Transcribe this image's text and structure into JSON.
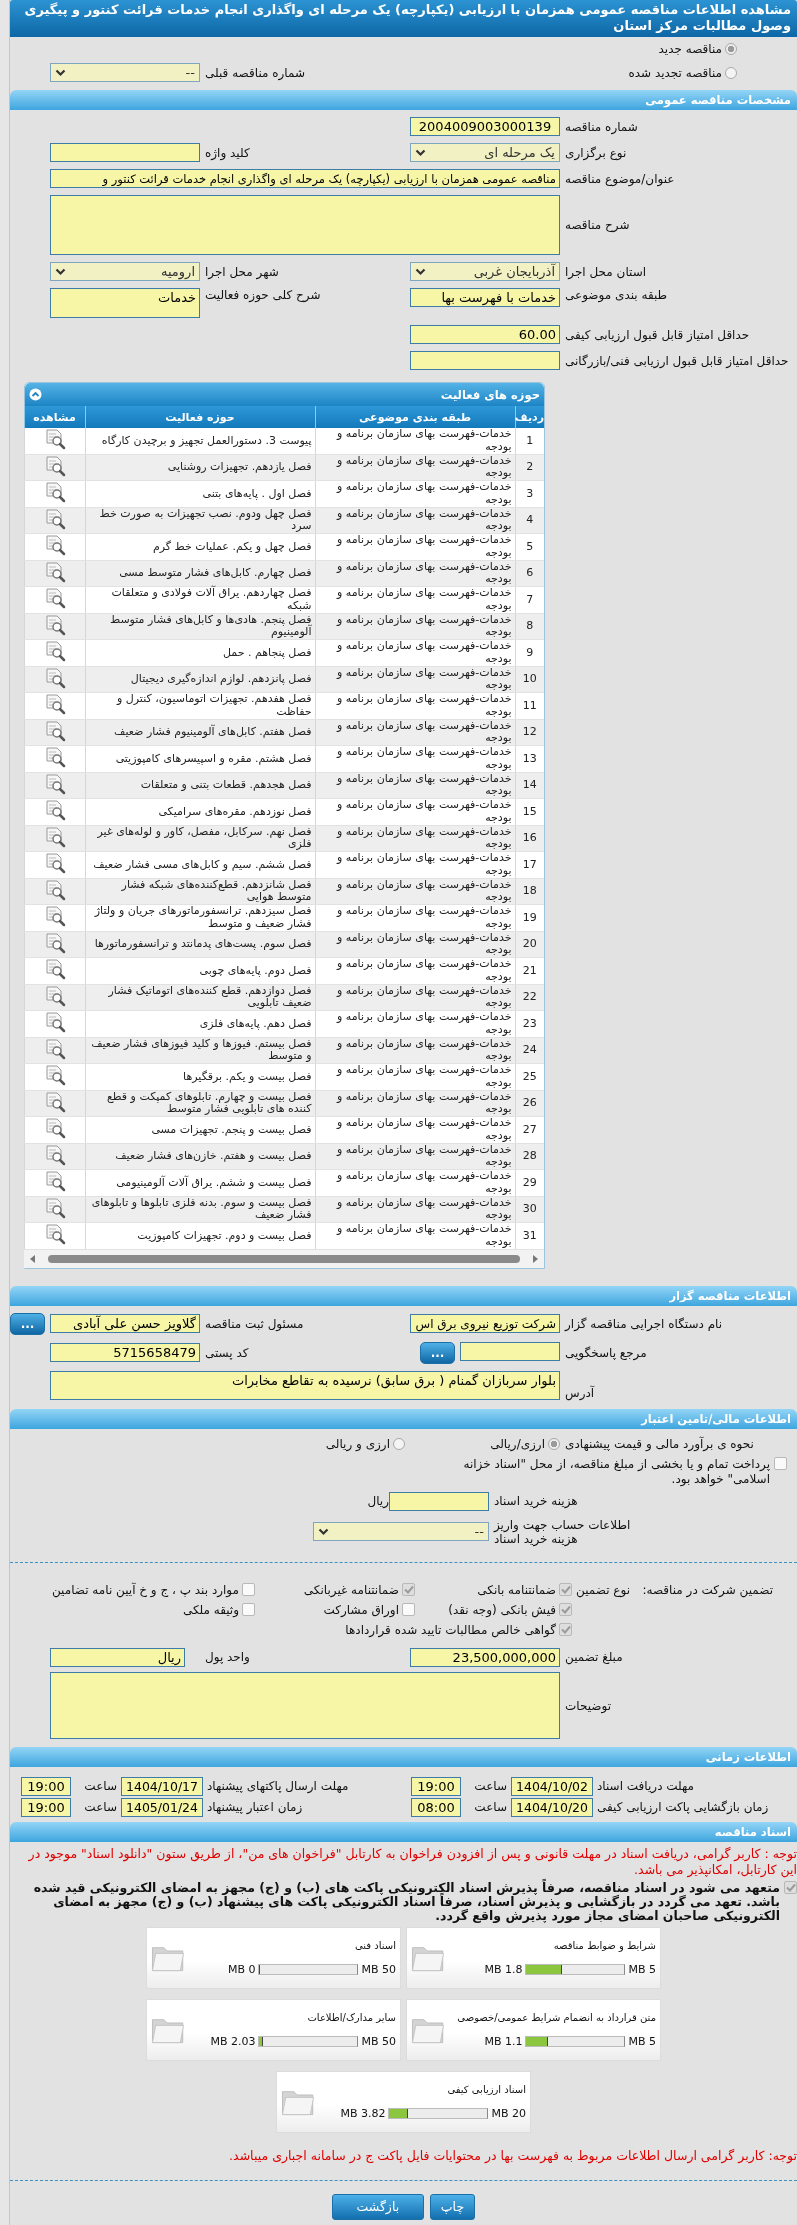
{
  "title": "مشاهده اطلاعات مناقصه عمومی همزمان با ارزیابی (یکپارچه) یک مرحله ای واگذاری انجام خدمات قرائت کنتور و پیگیری وصول مطالبات مرکز استان",
  "tender_status": [
    {
      "label": "مناقصه جدید",
      "selected": true
    },
    {
      "label": "مناقصه تجدید شده",
      "selected": false
    }
  ],
  "previous_tender": {
    "label": "شماره مناقصه قبلی",
    "value": "--"
  },
  "general": {
    "header": "مشخصات مناقصه عمومی",
    "tender_number": {
      "label": "شماره مناقصه",
      "value": "2004009003000139"
    },
    "holding_type": {
      "label": "نوع برگزاری",
      "value": "یک مرحله ای"
    },
    "keyword": {
      "label": "کلید واژه"
    },
    "subject": {
      "label": "عنوان/موضوع مناقصه",
      "value": "مناقصه عمومی همزمان با ارزیابی (یکپارچه) یک مرحله ای واگذاری انجام خدمات قرائت کنتور و"
    },
    "description": {
      "label": "شرح مناقصه"
    },
    "province": {
      "label": "استان محل اجرا",
      "value": "آذربایجان غربی"
    },
    "city": {
      "label": "شهر محل اجرا",
      "value": "ارومیه"
    },
    "category": {
      "label": "طبقه بندی موضوعی",
      "value": "خدمات با فهرست بها"
    },
    "activity_summary": {
      "label": "شرح کلی حوزه فعالیت",
      "value": "خدمات"
    },
    "min_quality_score": {
      "label": "حداقل امتیاز قابل قبول ارزیابی کیفی",
      "value": "60.00"
    },
    "min_technical_score": {
      "label": "حداقل امتیاز قابل قبول ارزیابی فنی/بازرگانی"
    }
  },
  "activities": {
    "header": "حوزه های فعالیت",
    "columns": [
      "ردیف",
      "طبقه بندی موضوعی",
      "حوزه فعالیت",
      "مشاهده"
    ],
    "rows": [
      {
        "index": "1",
        "category": "خدمات-فهرست بهای سازمان برنامه و بودجه",
        "activity": "پیوست 3. دستورالعمل تجهیز و برچیدن کارگاه"
      },
      {
        "index": "2",
        "category": "خدمات-فهرست بهای سازمان برنامه و بودجه",
        "activity": "فصل یازدهم. تجهیزات روشنایی"
      },
      {
        "index": "3",
        "category": "خدمات-فهرست بهای سازمان برنامه و بودجه",
        "activity": "فصل اول . پایه‌های بتنی"
      },
      {
        "index": "4",
        "category": "خدمات-فهرست بهای سازمان برنامه و بودجه",
        "activity": "فصل چهل ودوم. نصب تجهیزات به صورت خط سرد"
      },
      {
        "index": "5",
        "category": "خدمات-فهرست بهای سازمان برنامه و بودجه",
        "activity": "فصل چهل و یکم. عملیات خط گرم"
      },
      {
        "index": "6",
        "category": "خدمات-فهرست بهای سازمان برنامه و بودجه",
        "activity": "فصل چهارم. کابل‌های فشار متوسط مسی"
      },
      {
        "index": "7",
        "category": "خدمات-فهرست بهای سازمان برنامه و بودجه",
        "activity": "فصل چهاردهم. یراق آلات فولادی و متعلقات شبکه"
      },
      {
        "index": "8",
        "category": "خدمات-فهرست بهای سازمان برنامه و بودجه",
        "activity": "فصل پنجم. هادی‌ها و کابل‌های فشار متوسط آلومینیوم"
      },
      {
        "index": "9",
        "category": "خدمات-فهرست بهای سازمان برنامه و بودجه",
        "activity": "فصل پنجاهم . حمل"
      },
      {
        "index": "10",
        "category": "خدمات-فهرست بهای سازمان برنامه و بودجه",
        "activity": "فصل پانزدهم. لوازم اندازه‌گیری دیجیتال"
      },
      {
        "index": "11",
        "category": "خدمات-فهرست بهای سازمان برنامه و بودجه",
        "activity": "فصل هفدهم. تجهیزات اتوماسیون، کنترل و حفاظت"
      },
      {
        "index": "12",
        "category": "خدمات-فهرست بهای سازمان برنامه و بودجه",
        "activity": "فصل هفتم. کابل‌های آلومینیوم فشار ضعیف"
      },
      {
        "index": "13",
        "category": "خدمات-فهرست بهای سازمان برنامه و بودجه",
        "activity": "فصل هشتم. مقره و اسپیسرهای کامپوزیتی"
      },
      {
        "index": "14",
        "category": "خدمات-فهرست بهای سازمان برنامه و بودجه",
        "activity": "فصل هجدهم. قطعات بتنی و متعلقات"
      },
      {
        "index": "15",
        "category": "خدمات-فهرست بهای سازمان برنامه و بودجه",
        "activity": "فصل نوزدهم. مقره‌های سرامیکی"
      },
      {
        "index": "16",
        "category": "خدمات-فهرست بهای سازمان برنامه و بودجه",
        "activity": "فصل نهم. سرکابل، مفصل، کاور و لوله‌های غیر فلزی"
      },
      {
        "index": "17",
        "category": "خدمات-فهرست بهای سازمان برنامه و بودجه",
        "activity": "فصل ششم. سیم و کابل‌های مسی فشار ضعیف"
      },
      {
        "index": "18",
        "category": "خدمات-فهرست بهای سازمان برنامه و بودجه",
        "activity": "فصل شانزدهم. قطع‌کننده‌های شبکه فشار متوسط هوایی"
      },
      {
        "index": "19",
        "category": "خدمات-فهرست بهای سازمان برنامه و بودجه",
        "activity": "فصل سیزدهم. ترانسفورماتورهای جریان و ولتاژ فشار ضعیف و متوسط"
      },
      {
        "index": "20",
        "category": "خدمات-فهرست بهای سازمان برنامه و بودجه",
        "activity": "فصل سوم. پست‌های پدمانتد و ترانسفورماتورها"
      },
      {
        "index": "21",
        "category": "خدمات-فهرست بهای سازمان برنامه و بودجه",
        "activity": "فصل دوم. پایه‌های چوبی"
      },
      {
        "index": "22",
        "category": "خدمات-فهرست بهای سازمان برنامه و بودجه",
        "activity": "فصل دوازدهم. قطع کننده‌های اتوماتیک فشار ضعیف تابلویی"
      },
      {
        "index": "23",
        "category": "خدمات-فهرست بهای سازمان برنامه و بودجه",
        "activity": "فصل دهم. پایه‌های فلزی"
      },
      {
        "index": "24",
        "category": "خدمات-فهرست بهای سازمان برنامه و بودجه",
        "activity": "فصل بیستم. فیوزها و کلید فیوزهای فشار ضعیف و متوسط"
      },
      {
        "index": "25",
        "category": "خدمات-فهرست بهای سازمان برنامه و بودجه",
        "activity": "فصل بیست و یکم. برقگیرها"
      },
      {
        "index": "26",
        "category": "خدمات-فهرست بهای سازمان برنامه و بودجه",
        "activity": "فصل بیست و چهارم. تابلوهای کمپکت و قطع کننده های تابلویی فشار متوسط"
      },
      {
        "index": "27",
        "category": "خدمات-فهرست بهای سازمان برنامه و بودجه",
        "activity": "فصل بیست و پنجم. تجهیزات مسی"
      },
      {
        "index": "28",
        "category": "خدمات-فهرست بهای سازمان برنامه و بودجه",
        "activity": "فصل بیست و هفتم. خازن‌های فشار ضعیف"
      },
      {
        "index": "29",
        "category": "خدمات-فهرست بهای سازمان برنامه و بودجه",
        "activity": "فصل بیست و ششم. یراق آلات آلومینیومی"
      },
      {
        "index": "30",
        "category": "خدمات-فهرست بهای سازمان برنامه و بودجه",
        "activity": "فصل بیست و سوم. بدنه فلزی تابلوها و تابلوهای فشار ضعیف"
      },
      {
        "index": "31",
        "category": "خدمات-فهرست بهای سازمان برنامه و بودجه",
        "activity": "فصل بیست و دوم. تجهیزات کامپوزیت"
      }
    ]
  },
  "tenderer": {
    "header": "اطلاعات مناقصه گزار",
    "organization": {
      "label": "نام دستگاه اجرایی مناقصه گزار",
      "value": "شرکت توزیع نیروی برق اس"
    },
    "registrar": {
      "label": "مسئول ثبت مناقصه",
      "value": "گلاویز حسن علی آبادی"
    },
    "registrar_button": "...",
    "response_ref": {
      "label": "مرجع پاسخگویی"
    },
    "response_button": "...",
    "postal_code": {
      "label": "کد پستی",
      "value": "5715658479"
    },
    "address": {
      "label": "آدرس",
      "value": "بلوار سربازان گمنام ( برق سابق) نرسیده به تقاطع مخابرات"
    }
  },
  "financial": {
    "header": "اطلاعات مالی/تامین اعتبار",
    "estimate_label": "نحوه ی برآورد مالی و قیمت پیشنهادی",
    "estimate_options": [
      {
        "label": "ارزی/ریالی",
        "selected": true
      },
      {
        "label": "ارزی و ریالی",
        "selected": false
      }
    ],
    "treasury": {
      "label": "پرداخت تمام و یا بخشی از مبلغ مناقصه، از محل \"اسناد خزانه اسلامی\" خواهد بود.",
      "checked": false
    },
    "document_fee": {
      "label": "هزینه خرید اسناد",
      "unit": "ریال"
    },
    "account": {
      "label": "اطلاعات حساب جهت واریز هزینه خرید اسناد",
      "value": "--"
    },
    "guarantee_title": "تضمین شرکت در مناقصه:",
    "guarantee_type_label": "نوع تضمین",
    "guarantee_types": [
      {
        "label": "ضمانتنامه بانکی",
        "checked": true
      },
      {
        "label": "ضمانتنامه غیربانکی",
        "checked": true
      },
      {
        "label": "موارد بند پ ، ج و خ آیین نامه تضامین",
        "checked": false
      },
      {
        "label": "فیش بانکی (وجه نقد)",
        "checked": true
      },
      {
        "label": "اوراق مشارکت",
        "checked": false
      },
      {
        "label": "وثیقه ملکی",
        "checked": false
      },
      {
        "label": "گواهی خالص مطالبات تایید شده قراردادها",
        "checked": true
      }
    ],
    "guarantee_amount": {
      "label": "مبلغ تضمین",
      "value": "23,500,000,000"
    },
    "currency": {
      "label": "واحد پول",
      "value": "ریال"
    },
    "notes": {
      "label": "توضیحات"
    }
  },
  "schedule": {
    "header": "اطلاعات زمانی",
    "items": [
      {
        "label": "مهلت دریافت اسناد",
        "date": "1404/10/02",
        "time_label": "ساعت",
        "time": "19:00"
      },
      {
        "label": "مهلت ارسال پاکتهای پیشنهاد",
        "date": "1404/10/17",
        "time_label": "ساعت",
        "time": "19:00"
      },
      {
        "label": "زمان بازگشایی پاکت ارزیابی کیفی",
        "date": "1404/10/20",
        "time_label": "ساعت",
        "time": "08:00"
      },
      {
        "label": "زمان اعتبار پیشنهاد",
        "date": "1405/01/24",
        "time_label": "ساعت",
        "time": "19:00"
      }
    ]
  },
  "documents": {
    "header": "اسناد مناقصه",
    "notice": "توجه : کاربر گرامی، دریافت اسناد در مهلت قانونی و پس از افزودن فراخوان به کارتابل \"فراخوان های من\"، از طریق ستون \"دانلود اسناد\" موجود در این کارتابل، امکانپذیر می باشد.",
    "commitment": {
      "text": "متعهد می شود در اسناد مناقصه، صرفاً پذیرش اسناد الکترونیکی پاکت های (ب) و (ج) مجهز به امضای الکترونیکی قید شده باشد. تعهد می گردد در بازگشایی و پذیرش اسناد، صرفاً اسناد الکترونیکی پاکت های پیشنهاد (ب) و (ج) مجهز به امضای الکترونیکی صاحبان امضای مجاز مورد پذیرش واقع گردد.",
      "checked": true
    },
    "files": [
      {
        "title": "شرایط و ضوابط مناقصه",
        "used": "1.8 MB",
        "max": "5 MB",
        "level": 0.36
      },
      {
        "title": "اسناد فنی",
        "used": "0 MB",
        "max": "50 MB",
        "level": 0
      },
      {
        "title": "متن قرارداد به انضمام شرایط عمومی/خصوصی",
        "used": "1.1 MB",
        "max": "5 MB",
        "level": 0.22
      },
      {
        "title": "سایر مدارک/اطلاعات",
        "used": "2.03 MB",
        "max": "50 MB",
        "level": 0.04
      },
      {
        "title": "اسناد ارزیابی کیفی",
        "used": "3.82 MB",
        "max": "20 MB",
        "level": 0.19
      }
    ],
    "footer_notice": "توجه: کاربر گرامی ارسال اطلاعات مربوط به فهرست بها در محتوایات فایل پاکت ج در سامانه اجباری میباشد."
  },
  "buttons": [
    "چاپ",
    "بازگشت"
  ]
}
